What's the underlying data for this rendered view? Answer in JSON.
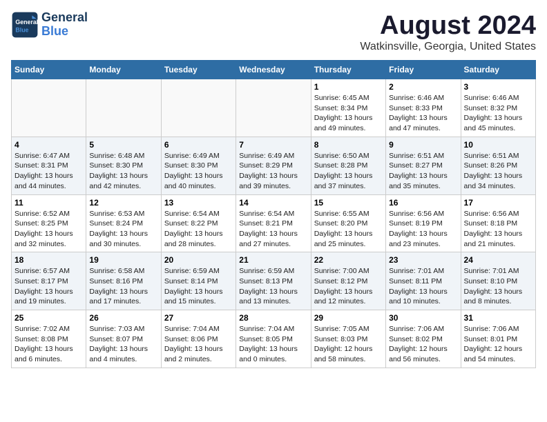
{
  "header": {
    "logo_general": "General",
    "logo_blue": "Blue",
    "month_year": "August 2024",
    "location": "Watkinsville, Georgia, United States"
  },
  "weekdays": [
    "Sunday",
    "Monday",
    "Tuesday",
    "Wednesday",
    "Thursday",
    "Friday",
    "Saturday"
  ],
  "weeks": [
    [
      {
        "day": "",
        "info": ""
      },
      {
        "day": "",
        "info": ""
      },
      {
        "day": "",
        "info": ""
      },
      {
        "day": "",
        "info": ""
      },
      {
        "day": "1",
        "info": "Sunrise: 6:45 AM\nSunset: 8:34 PM\nDaylight: 13 hours\nand 49 minutes."
      },
      {
        "day": "2",
        "info": "Sunrise: 6:46 AM\nSunset: 8:33 PM\nDaylight: 13 hours\nand 47 minutes."
      },
      {
        "day": "3",
        "info": "Sunrise: 6:46 AM\nSunset: 8:32 PM\nDaylight: 13 hours\nand 45 minutes."
      }
    ],
    [
      {
        "day": "4",
        "info": "Sunrise: 6:47 AM\nSunset: 8:31 PM\nDaylight: 13 hours\nand 44 minutes."
      },
      {
        "day": "5",
        "info": "Sunrise: 6:48 AM\nSunset: 8:30 PM\nDaylight: 13 hours\nand 42 minutes."
      },
      {
        "day": "6",
        "info": "Sunrise: 6:49 AM\nSunset: 8:30 PM\nDaylight: 13 hours\nand 40 minutes."
      },
      {
        "day": "7",
        "info": "Sunrise: 6:49 AM\nSunset: 8:29 PM\nDaylight: 13 hours\nand 39 minutes."
      },
      {
        "day": "8",
        "info": "Sunrise: 6:50 AM\nSunset: 8:28 PM\nDaylight: 13 hours\nand 37 minutes."
      },
      {
        "day": "9",
        "info": "Sunrise: 6:51 AM\nSunset: 8:27 PM\nDaylight: 13 hours\nand 35 minutes."
      },
      {
        "day": "10",
        "info": "Sunrise: 6:51 AM\nSunset: 8:26 PM\nDaylight: 13 hours\nand 34 minutes."
      }
    ],
    [
      {
        "day": "11",
        "info": "Sunrise: 6:52 AM\nSunset: 8:25 PM\nDaylight: 13 hours\nand 32 minutes."
      },
      {
        "day": "12",
        "info": "Sunrise: 6:53 AM\nSunset: 8:24 PM\nDaylight: 13 hours\nand 30 minutes."
      },
      {
        "day": "13",
        "info": "Sunrise: 6:54 AM\nSunset: 8:22 PM\nDaylight: 13 hours\nand 28 minutes."
      },
      {
        "day": "14",
        "info": "Sunrise: 6:54 AM\nSunset: 8:21 PM\nDaylight: 13 hours\nand 27 minutes."
      },
      {
        "day": "15",
        "info": "Sunrise: 6:55 AM\nSunset: 8:20 PM\nDaylight: 13 hours\nand 25 minutes."
      },
      {
        "day": "16",
        "info": "Sunrise: 6:56 AM\nSunset: 8:19 PM\nDaylight: 13 hours\nand 23 minutes."
      },
      {
        "day": "17",
        "info": "Sunrise: 6:56 AM\nSunset: 8:18 PM\nDaylight: 13 hours\nand 21 minutes."
      }
    ],
    [
      {
        "day": "18",
        "info": "Sunrise: 6:57 AM\nSunset: 8:17 PM\nDaylight: 13 hours\nand 19 minutes."
      },
      {
        "day": "19",
        "info": "Sunrise: 6:58 AM\nSunset: 8:16 PM\nDaylight: 13 hours\nand 17 minutes."
      },
      {
        "day": "20",
        "info": "Sunrise: 6:59 AM\nSunset: 8:14 PM\nDaylight: 13 hours\nand 15 minutes."
      },
      {
        "day": "21",
        "info": "Sunrise: 6:59 AM\nSunset: 8:13 PM\nDaylight: 13 hours\nand 13 minutes."
      },
      {
        "day": "22",
        "info": "Sunrise: 7:00 AM\nSunset: 8:12 PM\nDaylight: 13 hours\nand 12 minutes."
      },
      {
        "day": "23",
        "info": "Sunrise: 7:01 AM\nSunset: 8:11 PM\nDaylight: 13 hours\nand 10 minutes."
      },
      {
        "day": "24",
        "info": "Sunrise: 7:01 AM\nSunset: 8:10 PM\nDaylight: 13 hours\nand 8 minutes."
      }
    ],
    [
      {
        "day": "25",
        "info": "Sunrise: 7:02 AM\nSunset: 8:08 PM\nDaylight: 13 hours\nand 6 minutes."
      },
      {
        "day": "26",
        "info": "Sunrise: 7:03 AM\nSunset: 8:07 PM\nDaylight: 13 hours\nand 4 minutes."
      },
      {
        "day": "27",
        "info": "Sunrise: 7:04 AM\nSunset: 8:06 PM\nDaylight: 13 hours\nand 2 minutes."
      },
      {
        "day": "28",
        "info": "Sunrise: 7:04 AM\nSunset: 8:05 PM\nDaylight: 13 hours\nand 0 minutes."
      },
      {
        "day": "29",
        "info": "Sunrise: 7:05 AM\nSunset: 8:03 PM\nDaylight: 12 hours\nand 58 minutes."
      },
      {
        "day": "30",
        "info": "Sunrise: 7:06 AM\nSunset: 8:02 PM\nDaylight: 12 hours\nand 56 minutes."
      },
      {
        "day": "31",
        "info": "Sunrise: 7:06 AM\nSunset: 8:01 PM\nDaylight: 12 hours\nand 54 minutes."
      }
    ]
  ]
}
